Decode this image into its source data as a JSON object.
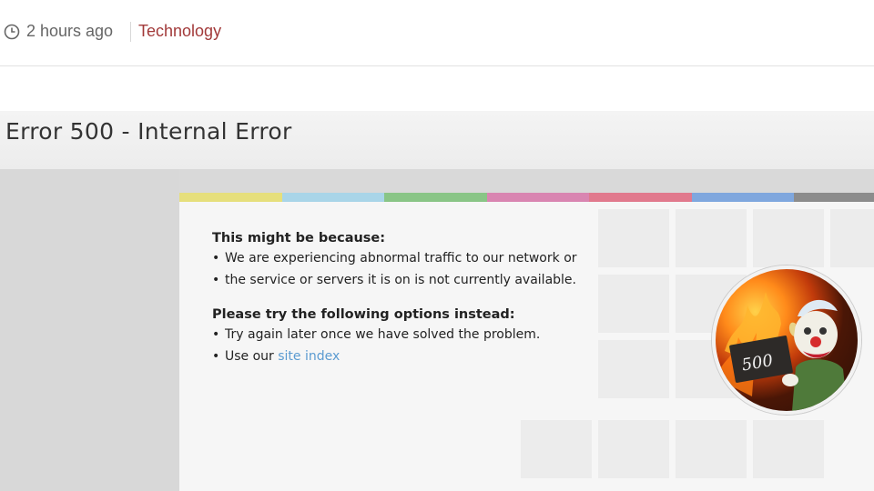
{
  "meta": {
    "time_ago": "2 hours ago",
    "category": "Technology"
  },
  "page": {
    "title": "Error 500 - Internal Error",
    "reasons_heading": "This might be because:",
    "reasons": [
      "We are experiencing abnormal traffic to our network or",
      "the service or servers it is on is not currently available."
    ],
    "options_heading": "Please try the following options instead:",
    "option_1": "Try again later once we have solved the problem.",
    "option_2_prefix": "Use our ",
    "option_2_link": "site index"
  },
  "badge": {
    "label": "500",
    "icon": "clown-holding-500-sign-icon"
  },
  "colors": {
    "category": "#a23a3a",
    "link": "#5b9bd1",
    "stripe": [
      "#e6df7c",
      "#a9d5e8",
      "#89c586",
      "#d985b1",
      "#e1798d",
      "#7fa7de",
      "#8c8c8c"
    ]
  }
}
